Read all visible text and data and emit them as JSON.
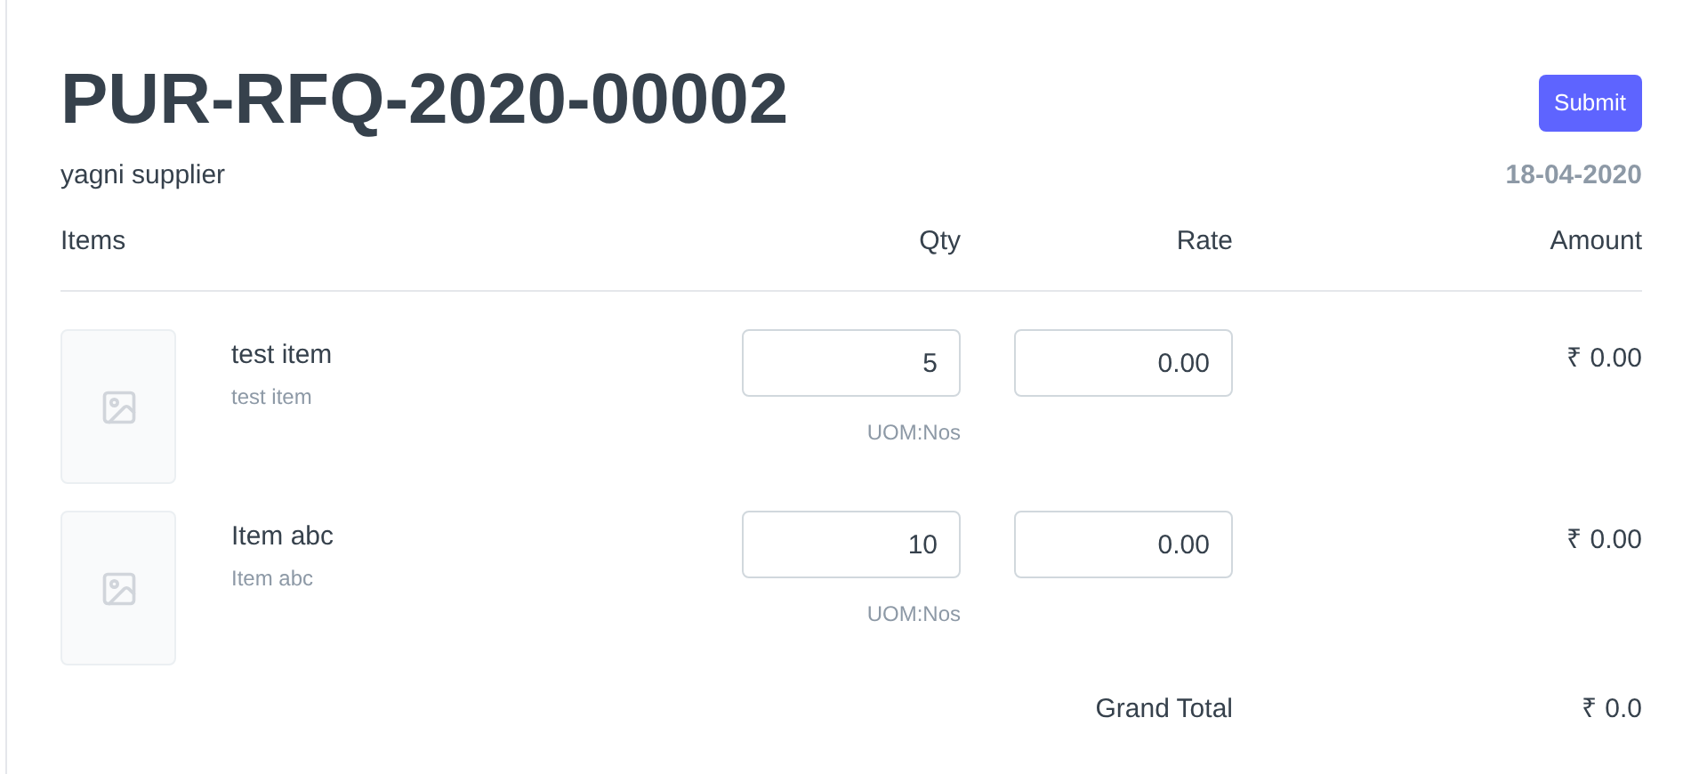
{
  "title": "PUR-RFQ-2020-00002",
  "supplier": "yagni supplier",
  "submit_button": "Submit",
  "date": "18-04-2020",
  "columns": [
    "Items",
    "Qty",
    "Rate",
    "Amount"
  ],
  "items": [
    {
      "name": "test item",
      "description": "test item",
      "qty": "5",
      "uom": "UOM:Nos",
      "rate": "0.00",
      "amount": "₹ 0.00"
    },
    {
      "name": "Item abc",
      "description": "Item abc",
      "qty": "10",
      "uom": "UOM:Nos",
      "rate": "0.00",
      "amount": "₹ 0.00"
    }
  ],
  "grand_total": {
    "label": "Grand Total",
    "value": "₹ 0.0"
  }
}
